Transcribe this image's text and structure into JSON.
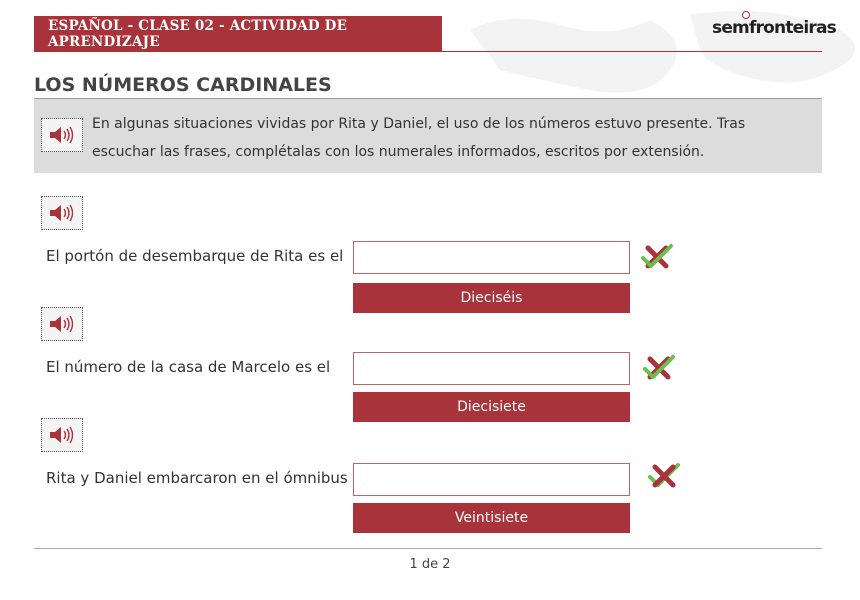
{
  "header": {
    "title": "ESPAÑOL - CLASE 02 - ACTIVIDAD DE APRENDIZAJE",
    "logo_part1": "sem",
    "logo_part2": "fronteiras",
    "accent_color": "#a8333b"
  },
  "section_title": "LOS NÚMEROS CARDINALES",
  "instruction": {
    "line1": "En algunas situaciones vividas por Rita y Daniel, el uso de los números estuvo presente. Tras",
    "line2": "escuchar las frases, complétalas con los numerales informados, escritos por extensión.",
    "icon": "speaker-icon"
  },
  "questions": [
    {
      "label": "El portón de desembarque de Rita es el",
      "value": "",
      "option": "Dieciséis",
      "feedback_icon": "check-cross-icon"
    },
    {
      "label": "El número de la casa de Marcelo es el",
      "value": "",
      "option": "Diecisiete",
      "feedback_icon": "check-cross-icon"
    },
    {
      "label": "Rita y Daniel embarcaron en el ómnibus",
      "value": "",
      "option": "Veintisiete",
      "feedback_icon": "cross-check-icon"
    }
  ],
  "footer": {
    "page": "1 de 2"
  }
}
